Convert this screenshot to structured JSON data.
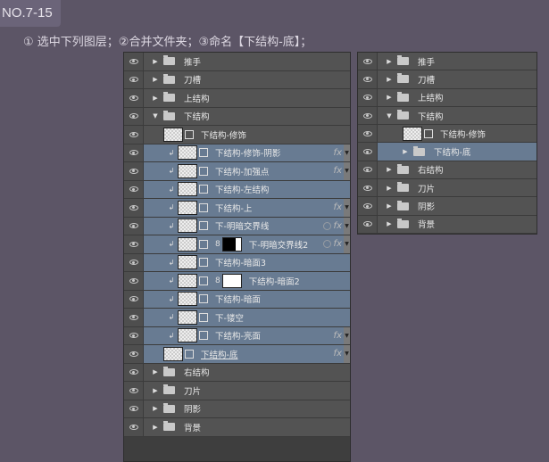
{
  "badge": "NO.7-15",
  "instruction": "① 选中下列图层；②合并文件夹；③命名【下结构-底】；",
  "colors": {
    "background": "#5c5566",
    "panel": "#535353",
    "selected": "#687b92"
  },
  "left_panel": {
    "rows": [
      {
        "label": "推手",
        "type": "folder",
        "indent": 0,
        "expanded": false
      },
      {
        "label": "刀槽",
        "type": "folder",
        "indent": 0,
        "expanded": false
      },
      {
        "label": "上结构",
        "type": "folder",
        "indent": 0,
        "expanded": false
      },
      {
        "label": "下结构",
        "type": "folder",
        "indent": 0,
        "expanded": true
      },
      {
        "label": "下结构-修饰",
        "type": "layer",
        "indent": 1
      },
      {
        "label": "下结构-修饰-阴影",
        "type": "layer",
        "indent": 2,
        "clip": true,
        "selected": true,
        "fx": true
      },
      {
        "label": "下结构-加强点",
        "type": "layer",
        "indent": 2,
        "clip": true,
        "selected": true,
        "fx": true
      },
      {
        "label": "下结构-左结构",
        "type": "layer",
        "indent": 2,
        "clip": true,
        "selected": true
      },
      {
        "label": "下结构-上",
        "type": "layer",
        "indent": 2,
        "clip": true,
        "selected": true,
        "fx": true
      },
      {
        "label": "下-明暗交界线",
        "type": "layer",
        "indent": 2,
        "clip": true,
        "selected": true,
        "fx": true,
        "circle": true
      },
      {
        "label": "下-明暗交界线2",
        "type": "layer",
        "indent": 2,
        "clip": true,
        "selected": true,
        "fx": true,
        "circle": true,
        "mask": "black"
      },
      {
        "label": "下结构-暗面3",
        "type": "layer",
        "indent": 2,
        "clip": true,
        "selected": true
      },
      {
        "label": "下结构-暗面2",
        "type": "layer",
        "indent": 2,
        "clip": true,
        "selected": true,
        "mask": "white"
      },
      {
        "label": "下结构-暗面",
        "type": "layer",
        "indent": 2,
        "clip": true,
        "selected": true
      },
      {
        "label": "下-镂空",
        "type": "layer",
        "indent": 2,
        "clip": true,
        "selected": true
      },
      {
        "label": "下结构-亮面",
        "type": "layer",
        "indent": 2,
        "clip": true,
        "selected": true,
        "fx": true
      },
      {
        "label": "下结构-底",
        "type": "layer",
        "indent": 1,
        "selected": true,
        "fx": true,
        "underline": true
      },
      {
        "label": "右结构",
        "type": "folder",
        "indent": 0,
        "expanded": false
      },
      {
        "label": "刀片",
        "type": "folder",
        "indent": 0,
        "expanded": false
      },
      {
        "label": "阴影",
        "type": "folder",
        "indent": 0,
        "expanded": false
      },
      {
        "label": "背景",
        "type": "folder",
        "indent": 0,
        "expanded": false
      }
    ]
  },
  "right_panel": {
    "rows": [
      {
        "label": "推手",
        "type": "folder",
        "indent": 0,
        "expanded": false
      },
      {
        "label": "刀槽",
        "type": "folder",
        "indent": 0,
        "expanded": false
      },
      {
        "label": "上结构",
        "type": "folder",
        "indent": 0,
        "expanded": false
      },
      {
        "label": "下结构",
        "type": "folder",
        "indent": 0,
        "expanded": true
      },
      {
        "label": "下结构-修饰",
        "type": "layer",
        "indent": 1
      },
      {
        "label": "下结构-底",
        "type": "folder",
        "indent": 1,
        "expanded": false,
        "selected": true
      },
      {
        "label": "右结构",
        "type": "folder",
        "indent": 0,
        "expanded": false
      },
      {
        "label": "刀片",
        "type": "folder",
        "indent": 0,
        "expanded": false
      },
      {
        "label": "阴影",
        "type": "folder",
        "indent": 0,
        "expanded": false
      },
      {
        "label": "背景",
        "type": "folder",
        "indent": 0,
        "expanded": false
      }
    ]
  }
}
